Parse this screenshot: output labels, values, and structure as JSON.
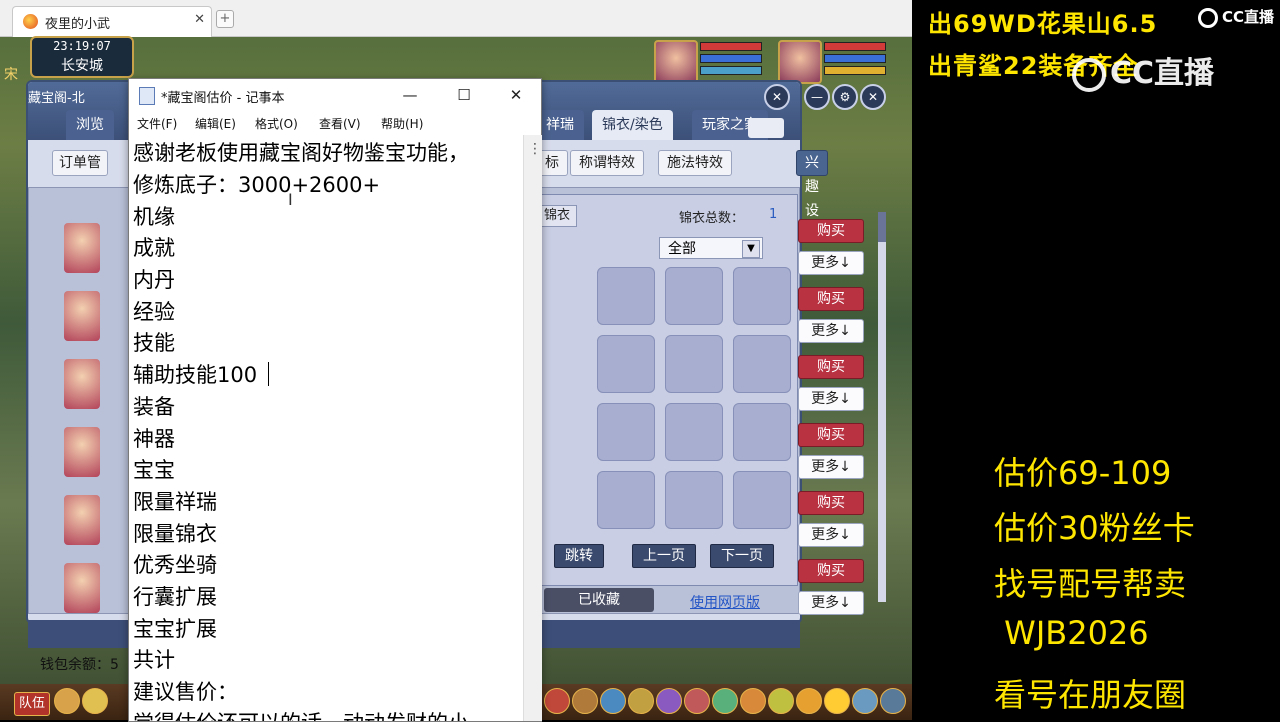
{
  "browser": {
    "tab_title": "夜里的小武",
    "close": "✕",
    "new_tab": "+"
  },
  "game": {
    "clock": "23:19:07",
    "location": "长安城",
    "side_text": "宋",
    "taskbar": {
      "team": "队伍"
    },
    "colors": {
      "hp": "#d23a3a",
      "mp": "#3a6fd8"
    }
  },
  "cbg": {
    "title": "藏宝阁-北",
    "tabs": [
      "浏览",
      "祥瑞",
      "锦衣/染色",
      "玩家之家"
    ],
    "active_tab": "锦衣/染色",
    "filters": {
      "order": "订单管",
      "flag": "标",
      "title_effect": "称谓特效",
      "spell_effect": "施法特效",
      "xingjie": "兴趣设置"
    },
    "panel": {
      "tag": "锦衣",
      "total_label": "锦衣总数：",
      "total_value": "1",
      "select_value": "全部",
      "jump": "跳转",
      "prev": "上一页",
      "next": "下一页",
      "collected": "已收藏",
      "web_link": "使用网页版"
    },
    "buy_label": "购买",
    "more_label": "更多↓",
    "wallet": "钱包余额：5"
  },
  "notepad": {
    "title": "*藏宝阁估价 - 记事本",
    "window_buttons": {
      "min": "—",
      "max": "☐",
      "close": "✕"
    },
    "menu": [
      "文件(F)",
      "编辑(E)",
      "格式(O)",
      "查看(V)",
      "帮助(H)"
    ],
    "scroll_dots": "⋮",
    "lines": [
      "感谢老板使用藏宝阁好物鉴宝功能，",
      "修炼底子：3000+2600+",
      "机缘",
      "成就",
      "内丹",
      "经验",
      "技能",
      "辅助技能100",
      "装备",
      "神器",
      "宝宝",
      "限量祥瑞",
      "限量锦衣",
      "优秀坐骑",
      "行囊扩展",
      "宝宝扩展",
      "共计",
      "建议售价：",
      "觉得估价还可以的话，动动发财的小"
    ]
  },
  "overlay": {
    "title1": "出69WD花果山6.5",
    "title2": "出青鲨22装备齐全",
    "logo_small": "CC直播",
    "logo_big": "CC直播",
    "lines": [
      "估价69-109",
      "估价30粉丝卡",
      "找号配号帮卖",
      " WJB2026",
      "看号在朋友圈"
    ],
    "text_color": "#ffe600"
  }
}
